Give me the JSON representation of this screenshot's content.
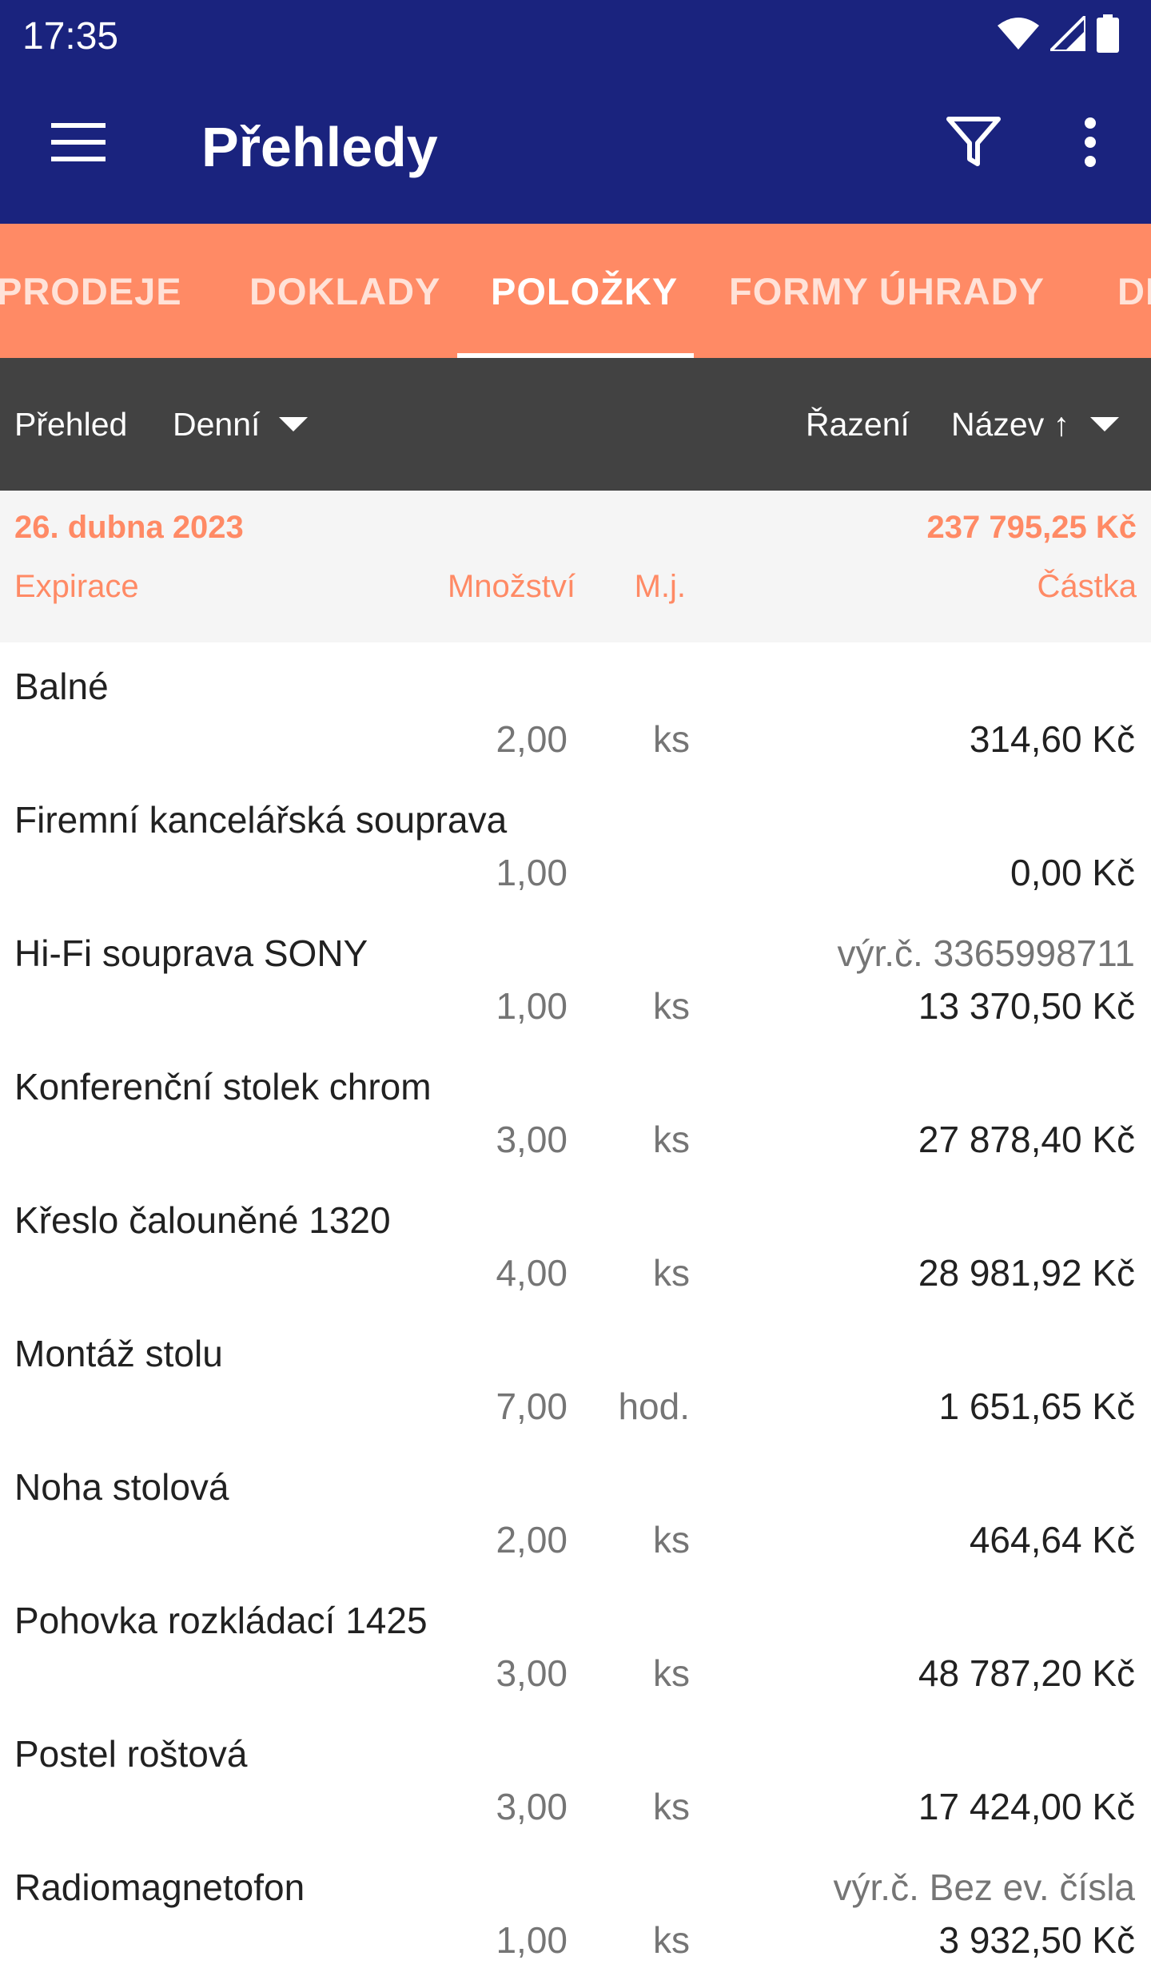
{
  "status_bar": {
    "time": "17:35",
    "icons": [
      "wifi-icon",
      "signal-icon",
      "battery-icon"
    ]
  },
  "app_bar": {
    "title": "Přehledy",
    "icons": [
      "menu-icon",
      "filter-icon",
      "more-vert-icon"
    ]
  },
  "tabs": [
    {
      "label": "PRODEJE",
      "active": false
    },
    {
      "label": "DOKLADY",
      "active": false
    },
    {
      "label": "POLOŽKY",
      "active": true
    },
    {
      "label": "FORMY ÚHRADY",
      "active": false
    },
    {
      "label": "DI",
      "active": false
    }
  ],
  "toolbar": {
    "overview_label": "Přehled",
    "overview_value": "Denní",
    "sort_label": "Řazení",
    "sort_value": "Název ↑"
  },
  "summary": {
    "date": "26. dubna 2023",
    "total": "237 795,25 Kč",
    "columns": {
      "expiration": "Expirace",
      "quantity": "Množství",
      "unit": "M.j.",
      "amount": "Částka"
    }
  },
  "items": [
    {
      "name": "Balné",
      "serial": "",
      "quantity": "2,00",
      "unit": "ks",
      "amount": "314,60 Kč"
    },
    {
      "name": "Firemní kancelářská souprava",
      "serial": "",
      "quantity": "1,00",
      "unit": "",
      "amount": "0,00 Kč"
    },
    {
      "name": "Hi-Fi souprava SONY",
      "serial": "výr.č. 3365998711",
      "quantity": "1,00",
      "unit": "ks",
      "amount": "13 370,50 Kč"
    },
    {
      "name": "Konferenční stolek chrom",
      "serial": "",
      "quantity": "3,00",
      "unit": "ks",
      "amount": "27 878,40 Kč"
    },
    {
      "name": "Křeslo čalouněné 1320",
      "serial": "",
      "quantity": "4,00",
      "unit": "ks",
      "amount": "28 981,92 Kč"
    },
    {
      "name": "Montáž stolu",
      "serial": "",
      "quantity": "7,00",
      "unit": "hod.",
      "amount": "1 651,65 Kč"
    },
    {
      "name": "Noha stolová",
      "serial": "",
      "quantity": "2,00",
      "unit": "ks",
      "amount": "464,64 Kč"
    },
    {
      "name": "Pohovka rozkládací 1425",
      "serial": "",
      "quantity": "3,00",
      "unit": "ks",
      "amount": "48 787,20 Kč"
    },
    {
      "name": "Postel roštová",
      "serial": "",
      "quantity": "3,00",
      "unit": "ks",
      "amount": "17 424,00 Kč"
    },
    {
      "name": "Radiomagnetofon",
      "serial": "výr.č. Bez ev. čísla",
      "quantity": "1,00",
      "unit": "ks",
      "amount": "3 932,50 Kč"
    }
  ],
  "colors": {
    "app_bar": "#1a237e",
    "tabs": "#ff8a65",
    "toolbar": "#424242",
    "accent": "#ff8a65"
  }
}
